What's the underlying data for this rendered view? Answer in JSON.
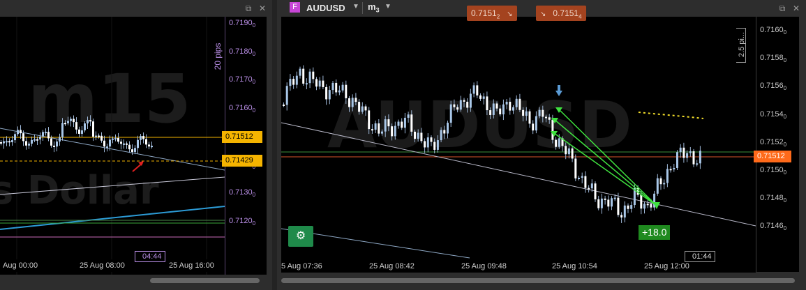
{
  "left_window": {
    "watermark_line1": "m15",
    "watermark_line2": "s Dollar",
    "range_label": "20 pips",
    "y_ticks": [
      "0.7190",
      "0.7180",
      "0.7170",
      "0.7160",
      "0.7150",
      "0.7140",
      "0.7130",
      "0.7120"
    ],
    "y_tick_subscript": "0",
    "price_tag_bid": "0.71512",
    "price_tag_line": "0.71429",
    "x_ticks": [
      "Aug 00:00",
      "25 Aug 08:00",
      "25 Aug 16:00"
    ],
    "time_tag": "04:44",
    "popout_icon": "popout-icon",
    "close_icon": "close-icon"
  },
  "right_window": {
    "type_badge": "F",
    "symbol": "AUDUSD",
    "timeframe_main": "m",
    "timeframe_sub": "3",
    "watermark": "AUDUSD",
    "sell_price_main": "0.7151",
    "sell_price_sub": "2",
    "buy_price_main": "0.7151",
    "buy_price_sub": "4",
    "range_label": "2.5 pi...",
    "y_ticks": [
      "0.7160",
      "0.7158",
      "0.7156",
      "0.7154",
      "0.7152",
      "0.7150",
      "0.7148",
      "0.7146"
    ],
    "y_tick_subscript": "0",
    "price_tag": "0.71512",
    "pnl_label": "+18.0",
    "x_ticks": [
      "5 Aug 07:36",
      "25 Aug 08:42",
      "25 Aug 09:48",
      "25 Aug 10:54",
      "25 Aug 12:00"
    ],
    "time_tag": "01:44",
    "popout_icon": "popout-icon",
    "close_icon": "close-icon"
  },
  "colors": {
    "chart_bg": "#000000",
    "panel_bg": "#2d2d2d",
    "bull_candle": "#a9c7e8",
    "bear_candle": "#ffffff",
    "bid_tag": "#f5b400",
    "ask_tag_right": "#ff6a1a",
    "order_box": "#a4431f",
    "pnl_box": "#1f8a1f",
    "signal_green": "#3fe13f",
    "left_axis_purple": "#b98ee6"
  }
}
